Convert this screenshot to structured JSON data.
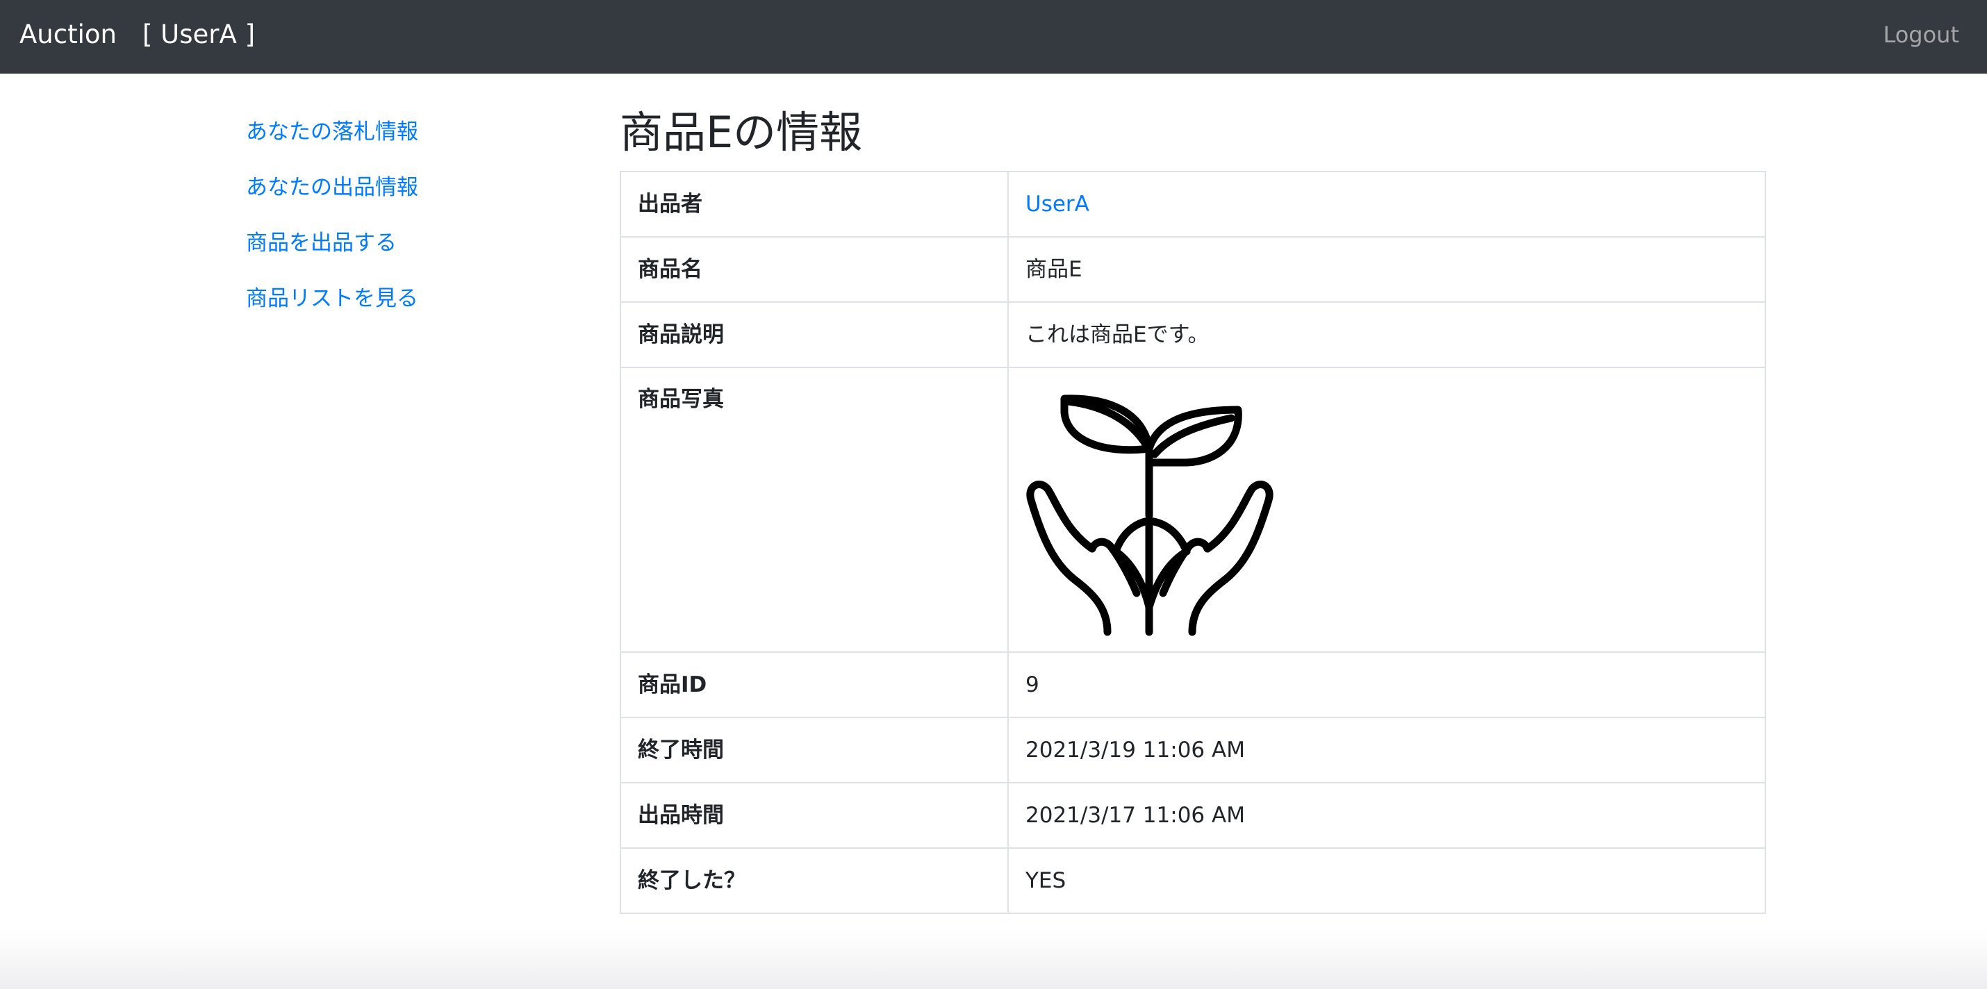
{
  "navbar": {
    "brand": "Auction　[ UserA ]",
    "logout_label": "Logout"
  },
  "sidebar": {
    "items": [
      {
        "label": "あなたの落札情報"
      },
      {
        "label": "あなたの出品情報"
      },
      {
        "label": "商品を出品する"
      },
      {
        "label": "商品リストを見る"
      }
    ]
  },
  "main": {
    "title": "商品Eの情報",
    "rows": [
      {
        "key": "出品者",
        "value": "UserA"
      },
      {
        "key": "商品名",
        "value": "商品E"
      },
      {
        "key": "商品説明",
        "value": "これは商品Eです。"
      },
      {
        "key": "商品写真",
        "icon": "plant-in-hands-icon"
      },
      {
        "key": "商品ID",
        "value": "9"
      },
      {
        "key": "終了時間",
        "value": "2021/3/19 11:06 AM"
      },
      {
        "key": "出品時間",
        "value": "2021/3/17 11:06 AM"
      },
      {
        "key": "終了した？",
        "value": "YES"
      }
    ]
  },
  "colors": {
    "navbar_bg": "#343a40",
    "link": "#007bff",
    "text": "#212529",
    "border": "#dee2e6"
  }
}
